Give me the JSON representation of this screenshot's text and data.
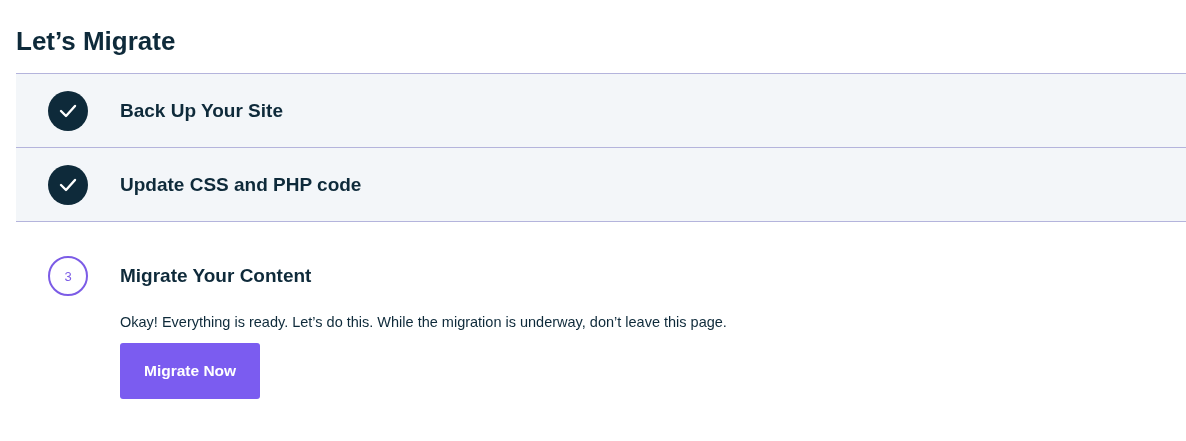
{
  "title": "Let’s Migrate",
  "steps": [
    {
      "label": "Back Up Your Site",
      "completed": true
    },
    {
      "label": "Update CSS and PHP code",
      "completed": true
    },
    {
      "label": "Migrate Your Content",
      "completed": false,
      "number": "3",
      "description": "Okay! Everything is ready. Let’s do this. While the migration is underway, don’t leave this page.",
      "button": "Migrate Now"
    }
  ]
}
